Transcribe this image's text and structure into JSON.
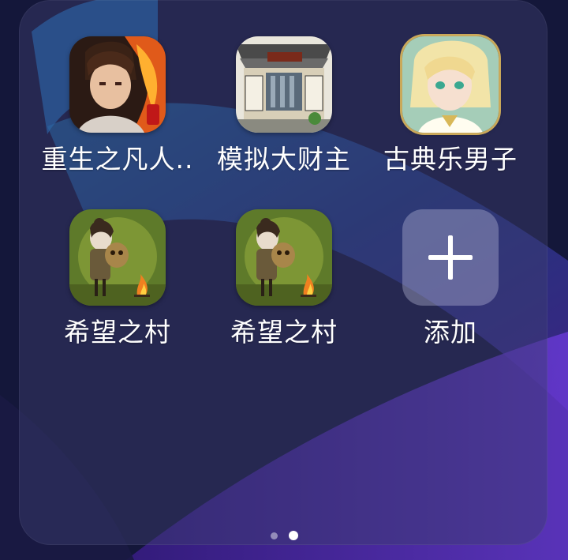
{
  "folder": {
    "apps": [
      {
        "label": "重生之凡人..",
        "icon": "anime-cultivator-icon"
      },
      {
        "label": "模拟大财主",
        "icon": "chinese-shop-icon"
      },
      {
        "label": "古典乐男子",
        "icon": "blonde-anime-boy-icon"
      },
      {
        "label": "希望之村",
        "icon": "village-girl-campfire-icon"
      },
      {
        "label": "希望之村",
        "icon": "village-girl-campfire-icon"
      },
      {
        "label": "添加",
        "icon": "plus-icon"
      }
    ]
  },
  "page_indicator": {
    "count": 2,
    "active_index": 1
  },
  "colors": {
    "panel": "#3c3e6e",
    "label_text": "#ffffff",
    "add_bg": "#c8c8e6"
  }
}
